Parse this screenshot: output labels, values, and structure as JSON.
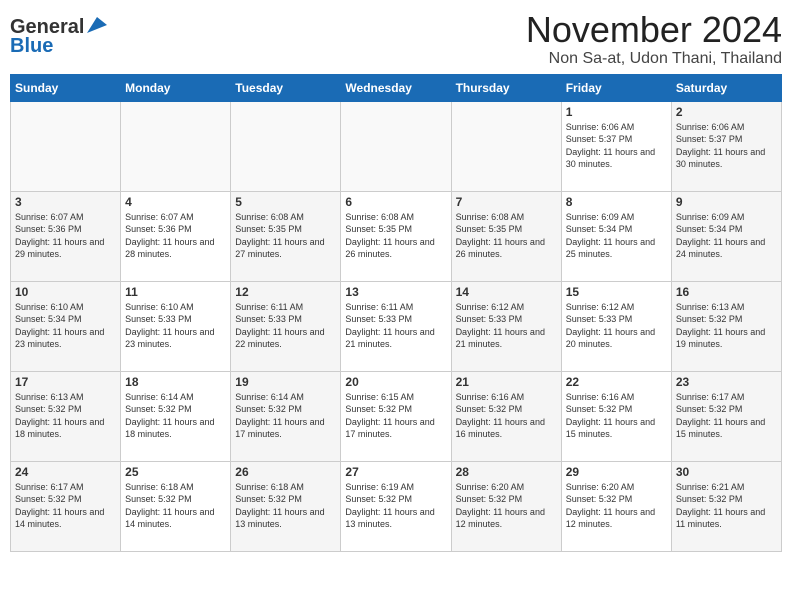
{
  "header": {
    "logo_general": "General",
    "logo_blue": "Blue",
    "month_title": "November 2024",
    "location": "Non Sa-at, Udon Thani, Thailand"
  },
  "days_of_week": [
    "Sunday",
    "Monday",
    "Tuesday",
    "Wednesday",
    "Thursday",
    "Friday",
    "Saturday"
  ],
  "weeks": [
    [
      {
        "day": "",
        "info": ""
      },
      {
        "day": "",
        "info": ""
      },
      {
        "day": "",
        "info": ""
      },
      {
        "day": "",
        "info": ""
      },
      {
        "day": "",
        "info": ""
      },
      {
        "day": "1",
        "info": "Sunrise: 6:06 AM\nSunset: 5:37 PM\nDaylight: 11 hours and 30 minutes."
      },
      {
        "day": "2",
        "info": "Sunrise: 6:06 AM\nSunset: 5:37 PM\nDaylight: 11 hours and 30 minutes."
      }
    ],
    [
      {
        "day": "3",
        "info": "Sunrise: 6:07 AM\nSunset: 5:36 PM\nDaylight: 11 hours and 29 minutes."
      },
      {
        "day": "4",
        "info": "Sunrise: 6:07 AM\nSunset: 5:36 PM\nDaylight: 11 hours and 28 minutes."
      },
      {
        "day": "5",
        "info": "Sunrise: 6:08 AM\nSunset: 5:35 PM\nDaylight: 11 hours and 27 minutes."
      },
      {
        "day": "6",
        "info": "Sunrise: 6:08 AM\nSunset: 5:35 PM\nDaylight: 11 hours and 26 minutes."
      },
      {
        "day": "7",
        "info": "Sunrise: 6:08 AM\nSunset: 5:35 PM\nDaylight: 11 hours and 26 minutes."
      },
      {
        "day": "8",
        "info": "Sunrise: 6:09 AM\nSunset: 5:34 PM\nDaylight: 11 hours and 25 minutes."
      },
      {
        "day": "9",
        "info": "Sunrise: 6:09 AM\nSunset: 5:34 PM\nDaylight: 11 hours and 24 minutes."
      }
    ],
    [
      {
        "day": "10",
        "info": "Sunrise: 6:10 AM\nSunset: 5:34 PM\nDaylight: 11 hours and 23 minutes."
      },
      {
        "day": "11",
        "info": "Sunrise: 6:10 AM\nSunset: 5:33 PM\nDaylight: 11 hours and 23 minutes."
      },
      {
        "day": "12",
        "info": "Sunrise: 6:11 AM\nSunset: 5:33 PM\nDaylight: 11 hours and 22 minutes."
      },
      {
        "day": "13",
        "info": "Sunrise: 6:11 AM\nSunset: 5:33 PM\nDaylight: 11 hours and 21 minutes."
      },
      {
        "day": "14",
        "info": "Sunrise: 6:12 AM\nSunset: 5:33 PM\nDaylight: 11 hours and 21 minutes."
      },
      {
        "day": "15",
        "info": "Sunrise: 6:12 AM\nSunset: 5:33 PM\nDaylight: 11 hours and 20 minutes."
      },
      {
        "day": "16",
        "info": "Sunrise: 6:13 AM\nSunset: 5:32 PM\nDaylight: 11 hours and 19 minutes."
      }
    ],
    [
      {
        "day": "17",
        "info": "Sunrise: 6:13 AM\nSunset: 5:32 PM\nDaylight: 11 hours and 18 minutes."
      },
      {
        "day": "18",
        "info": "Sunrise: 6:14 AM\nSunset: 5:32 PM\nDaylight: 11 hours and 18 minutes."
      },
      {
        "day": "19",
        "info": "Sunrise: 6:14 AM\nSunset: 5:32 PM\nDaylight: 11 hours and 17 minutes."
      },
      {
        "day": "20",
        "info": "Sunrise: 6:15 AM\nSunset: 5:32 PM\nDaylight: 11 hours and 17 minutes."
      },
      {
        "day": "21",
        "info": "Sunrise: 6:16 AM\nSunset: 5:32 PM\nDaylight: 11 hours and 16 minutes."
      },
      {
        "day": "22",
        "info": "Sunrise: 6:16 AM\nSunset: 5:32 PM\nDaylight: 11 hours and 15 minutes."
      },
      {
        "day": "23",
        "info": "Sunrise: 6:17 AM\nSunset: 5:32 PM\nDaylight: 11 hours and 15 minutes."
      }
    ],
    [
      {
        "day": "24",
        "info": "Sunrise: 6:17 AM\nSunset: 5:32 PM\nDaylight: 11 hours and 14 minutes."
      },
      {
        "day": "25",
        "info": "Sunrise: 6:18 AM\nSunset: 5:32 PM\nDaylight: 11 hours and 14 minutes."
      },
      {
        "day": "26",
        "info": "Sunrise: 6:18 AM\nSunset: 5:32 PM\nDaylight: 11 hours and 13 minutes."
      },
      {
        "day": "27",
        "info": "Sunrise: 6:19 AM\nSunset: 5:32 PM\nDaylight: 11 hours and 13 minutes."
      },
      {
        "day": "28",
        "info": "Sunrise: 6:20 AM\nSunset: 5:32 PM\nDaylight: 11 hours and 12 minutes."
      },
      {
        "day": "29",
        "info": "Sunrise: 6:20 AM\nSunset: 5:32 PM\nDaylight: 11 hours and 12 minutes."
      },
      {
        "day": "30",
        "info": "Sunrise: 6:21 AM\nSunset: 5:32 PM\nDaylight: 11 hours and 11 minutes."
      }
    ]
  ]
}
